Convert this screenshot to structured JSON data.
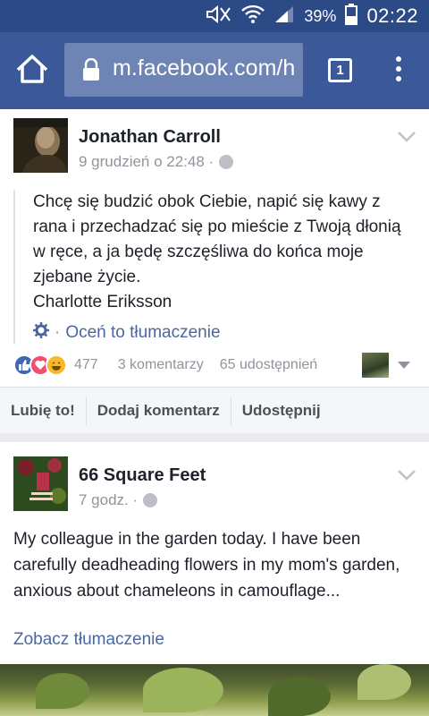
{
  "status_bar": {
    "battery": "39%",
    "time": "02:22"
  },
  "browser": {
    "url": "m.facebook.com/h",
    "tab_count": "1"
  },
  "posts": [
    {
      "author": "Jonathan Carroll",
      "timestamp": "9 grudzień o 22:48 ·",
      "quote": "Chcę się budzić obok Ciebie, napić się kawy z rana i przechadzać się po mieście z Twoją dłonią w ręce, a ja będę szczęśliwa do końca moje zjebane życie.",
      "quote_author": "Charlotte Eriksson",
      "translate_sep": "·",
      "translate_label": "Oceń to tłumaczenie",
      "reactions_count": "477",
      "comments": "3 komentarzy",
      "shares": "65 udostępnień",
      "actions": [
        "Lubię to!",
        "Dodaj komentarz",
        "Udostępnij"
      ]
    },
    {
      "author": "66 Square Feet",
      "timestamp": "7 godz. ·",
      "caption": "My colleague in the garden today. I have been carefully deadheading flowers in my mom's garden, anxious about chameleons in camouflage...",
      "see_translation": "Zobacz tłumaczenie"
    }
  ],
  "colors": {
    "facebook_blue": "#3b5998",
    "status_blue": "#2b4a86",
    "link_blue": "#4b67a1",
    "feed_bg": "#e9ebee"
  }
}
